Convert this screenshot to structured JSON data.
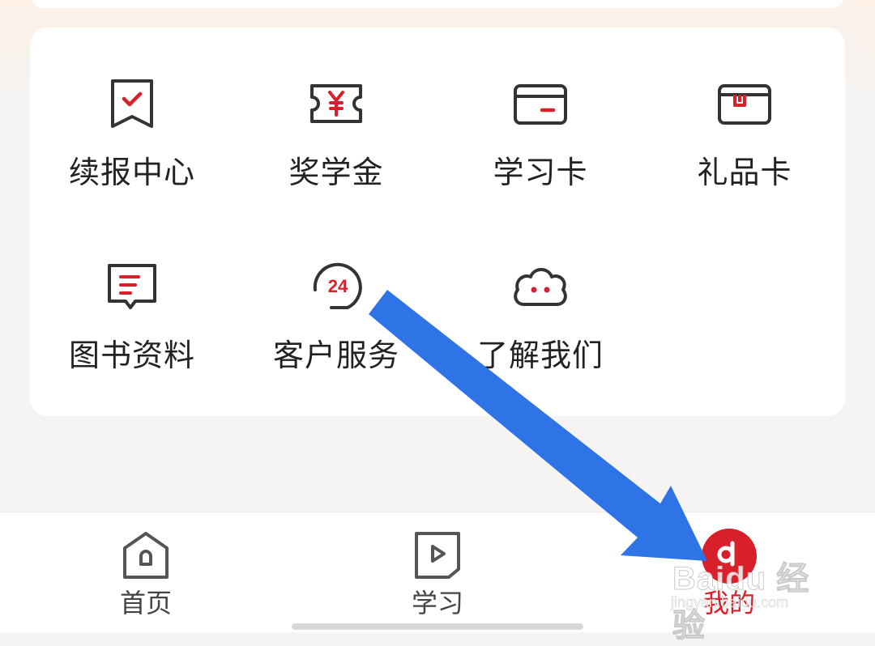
{
  "services": [
    {
      "label": "续报中心",
      "icon": "renewal-center-icon"
    },
    {
      "label": "奖学金",
      "icon": "scholarship-ticket-icon"
    },
    {
      "label": "学习卡",
      "icon": "study-card-icon"
    },
    {
      "label": "礼品卡",
      "icon": "gift-card-icon"
    },
    {
      "label": "图书资料",
      "icon": "book-materials-icon"
    },
    {
      "label": "客户服务",
      "icon": "customer-service-24-icon",
      "badge": "24"
    },
    {
      "label": "了解我们",
      "icon": "about-us-cloud-icon"
    }
  ],
  "tabbar": {
    "tabs": [
      {
        "label": "首页",
        "icon": "home-icon",
        "active": false
      },
      {
        "label": "学习",
        "icon": "study-play-icon",
        "active": false
      },
      {
        "label": "我的",
        "icon": "profile-icon",
        "active": true
      }
    ]
  },
  "watermark": {
    "brand": "Baidu 经验",
    "url": "jingyan.baidu.com"
  },
  "colors": {
    "accent": "#d8202a",
    "arrow": "#2f74e6",
    "icon_stroke": "#333333"
  }
}
